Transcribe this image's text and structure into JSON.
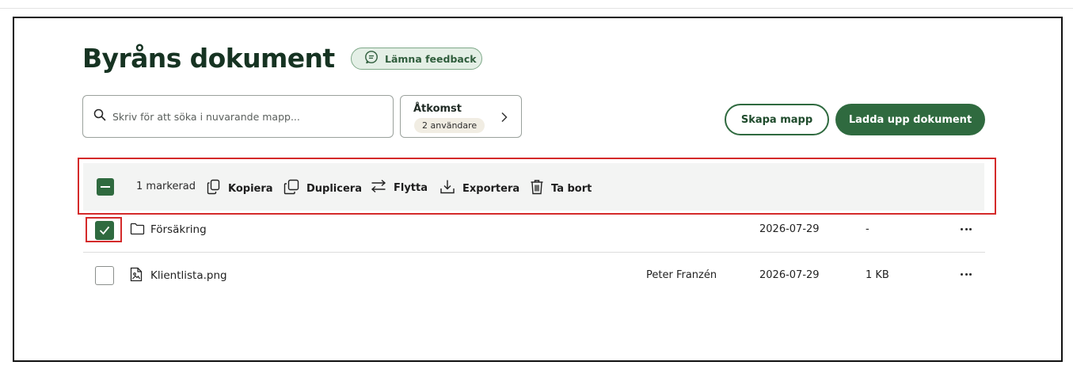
{
  "page": {
    "title": "Byråns dokument",
    "feedback_label": "Lämna feedback"
  },
  "search": {
    "placeholder": "Skriv för att söka i nuvarande mapp..."
  },
  "access": {
    "label": "Åtkomst",
    "badge": "2 användare"
  },
  "buttons": {
    "create_folder": "Skapa mapp",
    "upload": "Ladda upp dokument"
  },
  "toolbar": {
    "selected_count": "1 markerad",
    "actions": {
      "copy": "Kopiera",
      "duplicate": "Duplicera",
      "move": "Flytta",
      "export": "Exportera",
      "delete": "Ta bort"
    }
  },
  "rows": [
    {
      "name": "Försäkring",
      "type": "folder",
      "owner": "",
      "date": "2026-07-29",
      "size": "-",
      "checked": true
    },
    {
      "name": "Klientlista.png",
      "type": "image-file",
      "owner": "Peter Franzén",
      "date": "2026-07-29",
      "size": "1 KB",
      "checked": false
    }
  ],
  "colors": {
    "primary": "#2f6a3f",
    "title": "#163322",
    "highlight": "#d42a2a"
  }
}
